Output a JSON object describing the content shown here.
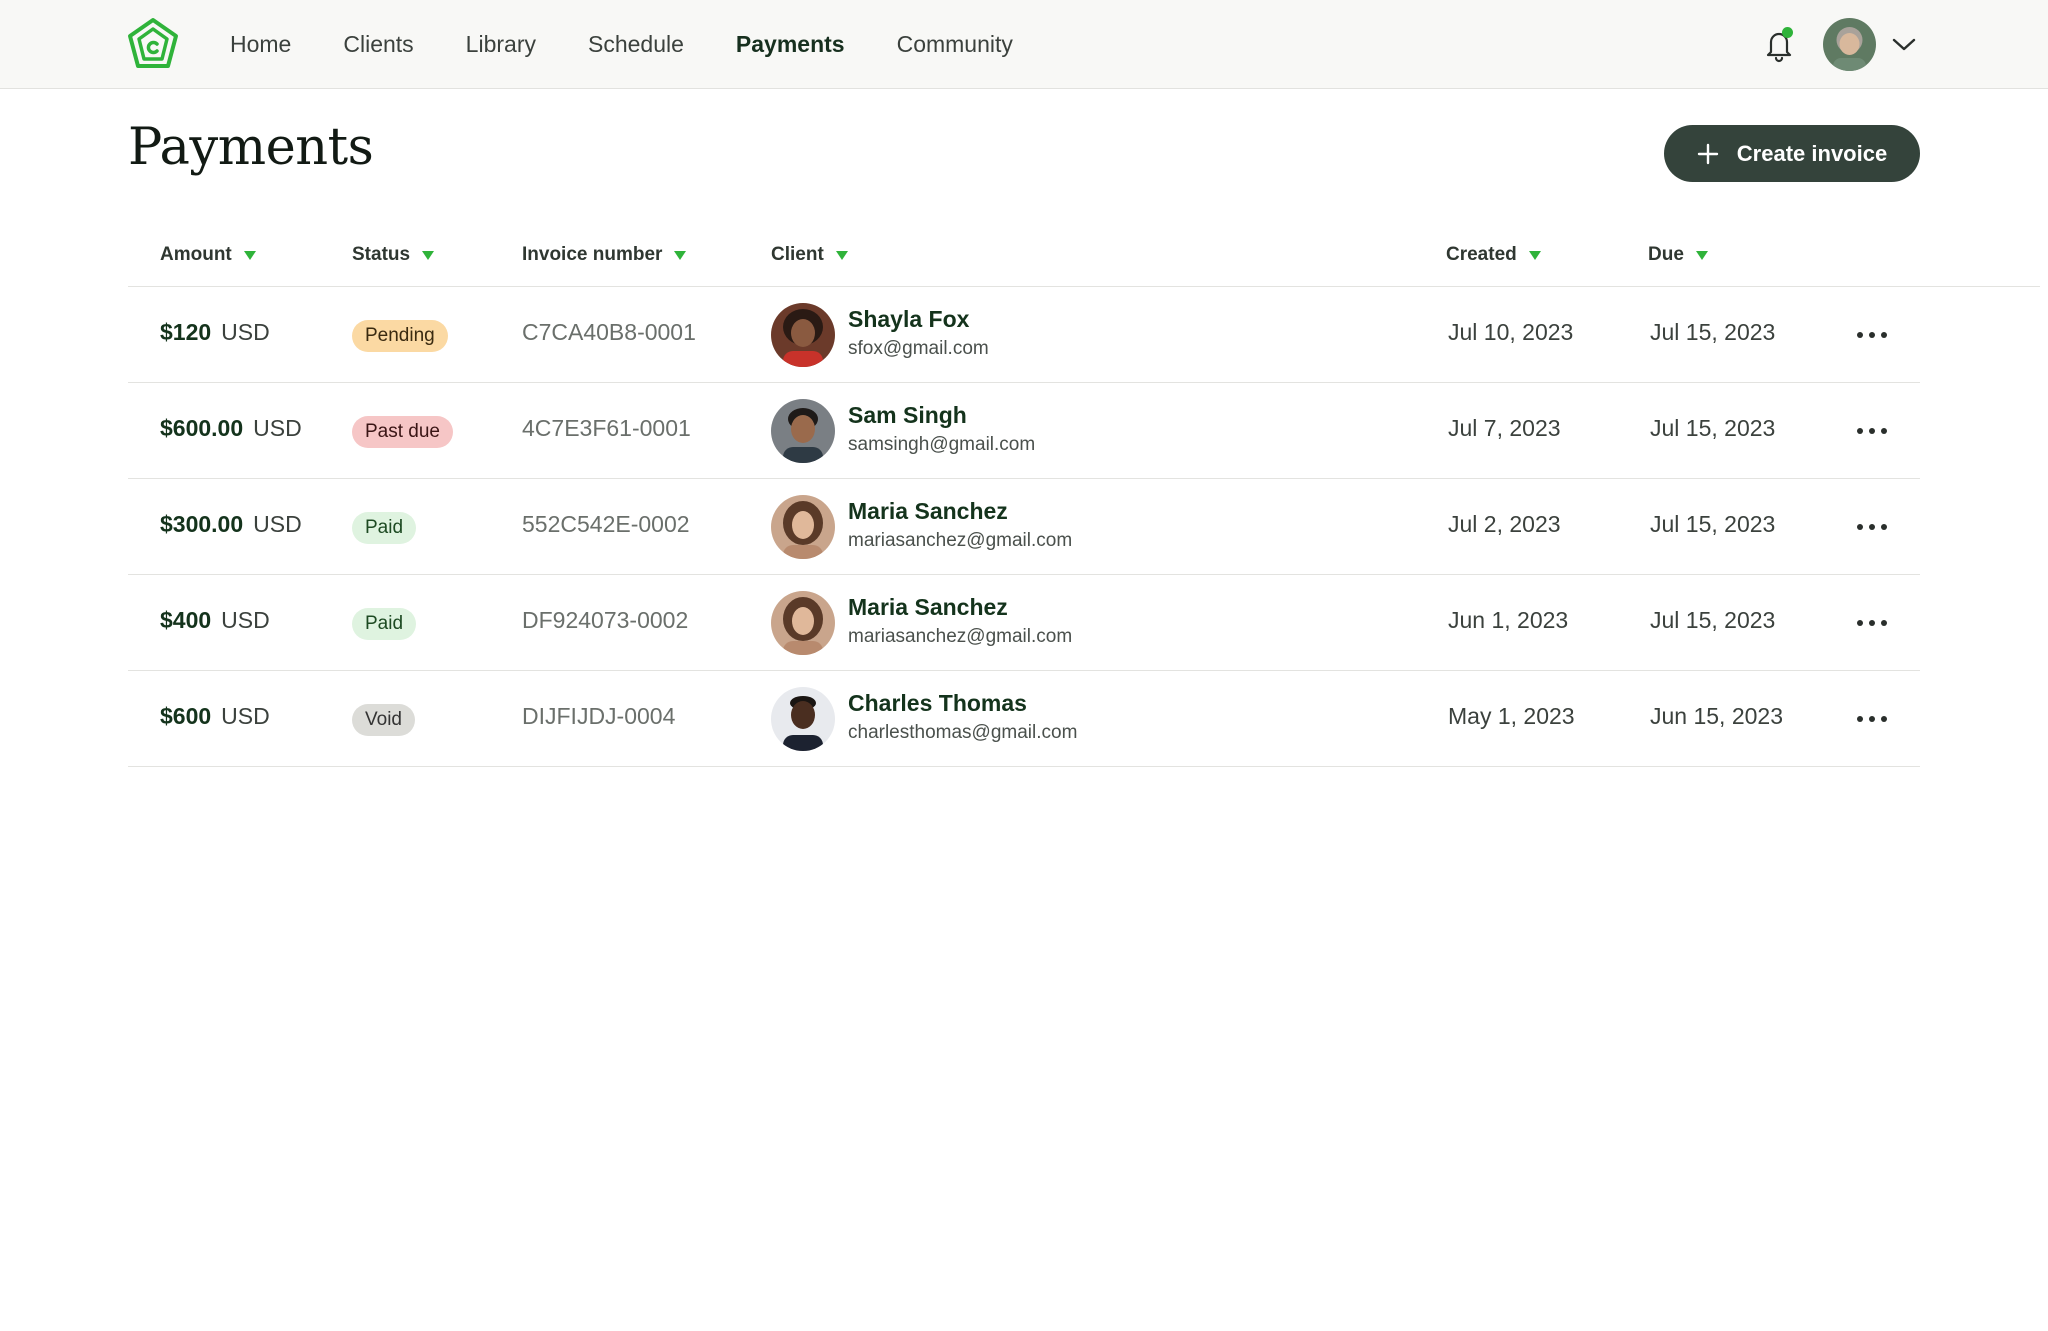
{
  "nav": {
    "items": [
      {
        "label": "Home",
        "active": false
      },
      {
        "label": "Clients",
        "active": false
      },
      {
        "label": "Library",
        "active": false
      },
      {
        "label": "Schedule",
        "active": false
      },
      {
        "label": "Payments",
        "active": true
      },
      {
        "label": "Community",
        "active": false
      }
    ],
    "notification_dot": true
  },
  "page": {
    "title": "Payments",
    "create_button_label": "Create invoice"
  },
  "table": {
    "columns": [
      "Amount",
      "Status",
      "Invoice number",
      "Client",
      "Created",
      "Due"
    ],
    "rows": [
      {
        "amount": "$120",
        "currency": "USD",
        "status": "Pending",
        "status_kind": "pending",
        "invoice": "C7CA40B8-0001",
        "client_name": "Shayla Fox",
        "client_email": "sfox@gmail.com",
        "created": "Jul 10, 2023",
        "due": "Jul 15, 2023"
      },
      {
        "amount": "$600.00",
        "currency": "USD",
        "status": "Past due",
        "status_kind": "pastdue",
        "invoice": "4C7E3F61-0001",
        "client_name": "Sam Singh",
        "client_email": "samsingh@gmail.com",
        "created": "Jul 7, 2023",
        "due": "Jul 15, 2023"
      },
      {
        "amount": "$300.00",
        "currency": "USD",
        "status": "Paid",
        "status_kind": "paid",
        "invoice": "552C542E-0002",
        "client_name": "Maria Sanchez",
        "client_email": "mariasanchez@gmail.com",
        "created": "Jul 2, 2023",
        "due": "Jul 15, 2023"
      },
      {
        "amount": "$400",
        "currency": "USD",
        "status": "Paid",
        "status_kind": "paid",
        "invoice": "DF924073-0002",
        "client_name": "Maria Sanchez",
        "client_email": "mariasanchez@gmail.com",
        "created": "Jun 1, 2023",
        "due": "Jul 15, 2023"
      },
      {
        "amount": "$600",
        "currency": "USD",
        "status": "Void",
        "status_kind": "void",
        "invoice": "DIJFIJDJ-0004",
        "client_name": "Charles Thomas",
        "client_email": "charlesthomas@gmail.com",
        "created": "May 1, 2023",
        "due": "Jun 15, 2023"
      }
    ]
  },
  "colors": {
    "brand_green": "#2fb33a",
    "button_dark": "#34433b",
    "nav_background": "#f8f8f6"
  },
  "icons": [
    "logo-icon",
    "bell-icon",
    "chevron-down-icon",
    "plus-icon",
    "sort-arrow-icon",
    "more-icon"
  ]
}
